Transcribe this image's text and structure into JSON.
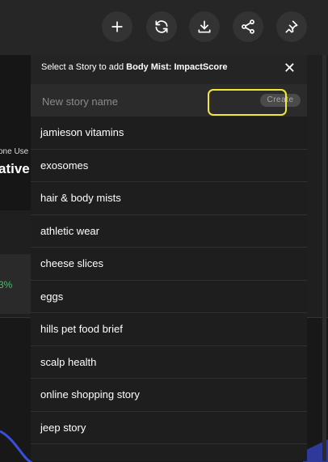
{
  "toolbar": {
    "buttons": [
      {
        "name": "add-icon"
      },
      {
        "name": "refresh-icon"
      },
      {
        "name": "download-icon"
      },
      {
        "name": "share-icon"
      },
      {
        "name": "pin-icon"
      }
    ]
  },
  "background": {
    "label": "one Use",
    "value": "ative",
    "percent": "3%"
  },
  "popover": {
    "title_prefix": "Select a Story to add ",
    "title_bold": "Body Mist: ImpactScore",
    "close": "✕",
    "new_story_placeholder": "New story name",
    "create_label": "Create",
    "stories": [
      "jamieson vitamins",
      "exosomes",
      "hair & body mists",
      "athletic wear",
      "cheese slices",
      "eggs",
      "hills pet food brief",
      "scalp health",
      "online shopping story",
      "jeep story"
    ]
  },
  "colors": {
    "accent_highlight": "#f3e63a",
    "positive": "#3cc36a",
    "chart_line": "#3a4fd8"
  }
}
